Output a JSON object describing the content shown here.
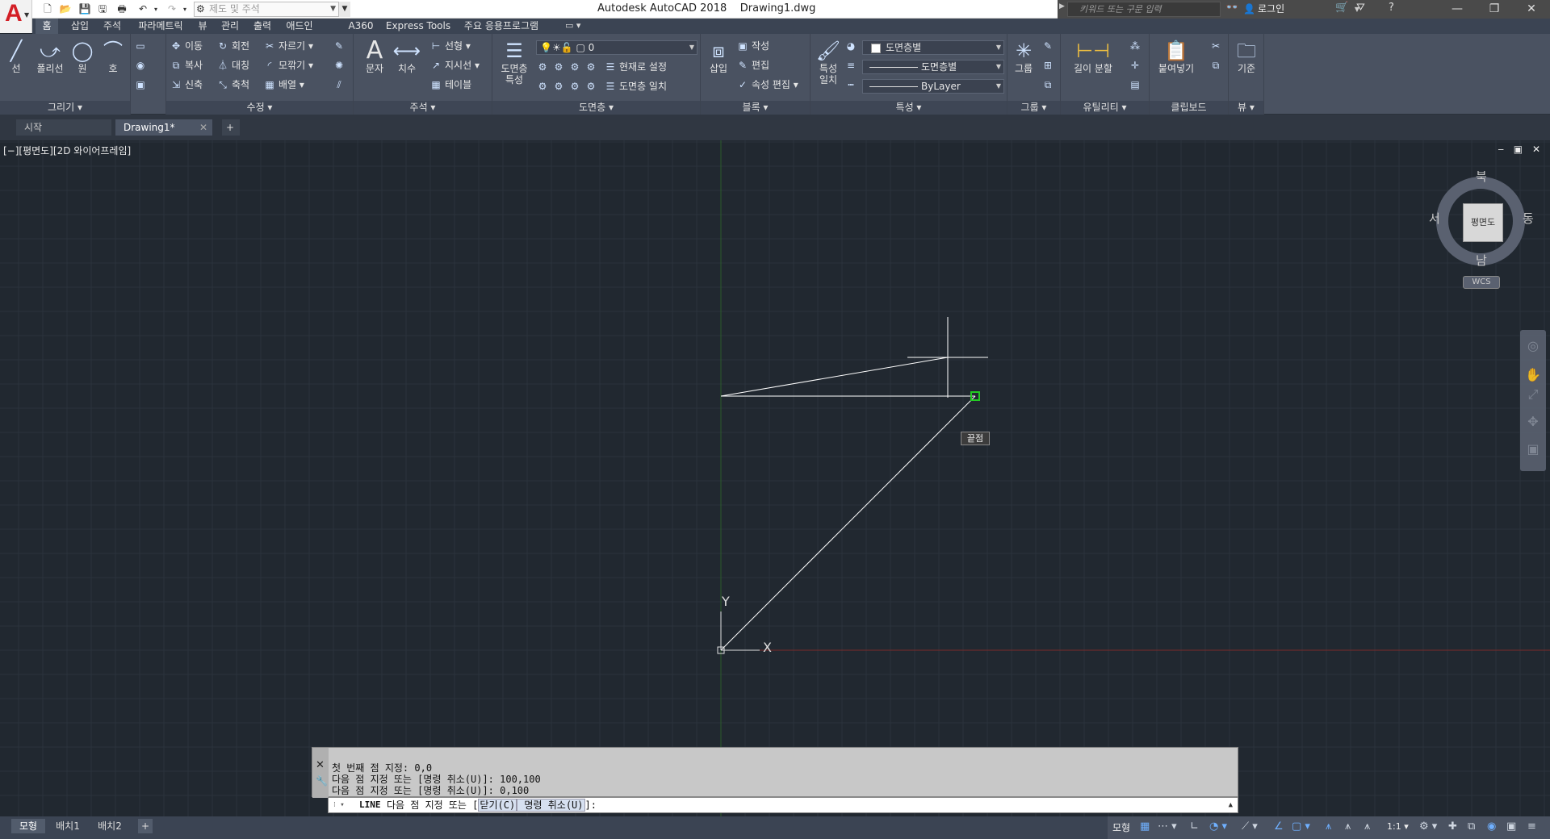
{
  "titlebar": {
    "title": "Autodesk AutoCAD 2018    Drawing1.dwg",
    "workspace": "제도 및 주석",
    "search_placeholder": "키워드 또는 구문 입력",
    "login": "로그인"
  },
  "ribbon_tabs": [
    "홈",
    "삽입",
    "주석",
    "파라메트릭",
    "뷰",
    "관리",
    "출력",
    "애드인",
    "A360",
    "Express Tools",
    "주요 응용프로그램"
  ],
  "panels": {
    "draw": {
      "footer": "그리기 ▾",
      "line": "선",
      "polyline": "폴리선",
      "circle": "원",
      "arc": "호"
    },
    "modify": {
      "footer": "수정 ▾",
      "move": "이동",
      "rotate": "회전",
      "trim": "자르기",
      "copy": "복사",
      "mirror": "대칭",
      "fillet": "모깎기",
      "stretch": "신축",
      "scale": "축척",
      "array": "배열"
    },
    "annotation": {
      "footer": "주석 ▾",
      "text": "문자",
      "dimension": "치수",
      "linear": "선형",
      "leader": "지시선",
      "table": "테이블"
    },
    "layers": {
      "footer": "도면층 ▾",
      "properties_line1": "도면층",
      "properties_line2": "특성",
      "current_layer": "0",
      "make_current": "현재로 설정",
      "match_layer": "도면층 일치"
    },
    "block": {
      "footer": "블록 ▾",
      "insert": "삽입",
      "create": "작성",
      "edit": "편집",
      "edit_attributes": "속성 편집"
    },
    "properties": {
      "footer": "특성 ▾",
      "match_line1": "특성",
      "match_line2": "일치",
      "color": "도면층별",
      "lineweight": "도면층별",
      "linetype": "ByLayer"
    },
    "groups": {
      "footer": "그룹 ▾",
      "group": "그룹"
    },
    "utilities": {
      "footer": "유틸리티 ▾",
      "measure": "길이 분할"
    },
    "clipboard": {
      "footer": "클립보드",
      "paste": "붙여넣기"
    },
    "view": {
      "footer": "뷰 ▾",
      "base": "기준"
    }
  },
  "file_tabs": {
    "start": "시작",
    "drawing": "Drawing1*",
    "close": "✕",
    "add": "+"
  },
  "viewport": {
    "label": "[−][평면도][2D 와이어프레임]",
    "controls": "‒ ▣ ✕",
    "snap_tooltip": "끝점"
  },
  "viewcube": {
    "face": "평면도",
    "north": "북",
    "south": "남",
    "east": "동",
    "west": "서",
    "ucs": "WCS"
  },
  "ucs_icon": {
    "x": "X",
    "y": "Y"
  },
  "command_history": [
    "첫 번째 점 지정: 0,0",
    "다음 점 지정 또는 [명령 취소(U)]: 100,100",
    "다음 점 지정 또는 [명령 취소(U)]: 0,100"
  ],
  "command_line": {
    "command": "LINE",
    "prompt_start": "다음 점 지정 또는 [",
    "option_close_label": "닫기",
    "option_close_key": "(C)",
    "option_undo_label": " 명령 취소",
    "option_undo_key": "(U)",
    "prompt_end": "]:"
  },
  "layout_tabs": [
    "모형",
    "배치1",
    "배치2",
    "+"
  ],
  "statusbar": {
    "model": "모형",
    "scale": "1:1 ▾"
  },
  "colors": {
    "canvas_bg": "#212830",
    "ribbon_bg": "#4a5261",
    "drawn_line": "#ffffff",
    "ucs_x_axis": "#7a2a2a",
    "ucs_y_axis": "#2a5a2a",
    "snap_marker": "#22cc22"
  },
  "drawing": {
    "units": "drawing units",
    "entities": [
      {
        "type": "line",
        "from": [
          0,
          0
        ],
        "to": [
          100,
          100
        ]
      },
      {
        "type": "line",
        "from": [
          100,
          100
        ],
        "to": [
          0,
          100
        ]
      },
      {
        "type": "rubber-band",
        "from": [
          0,
          100
        ],
        "to_cursor": true
      }
    ]
  }
}
